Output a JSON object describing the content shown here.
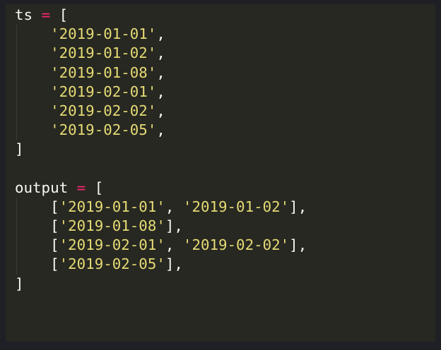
{
  "colors": {
    "background": "#1e2026",
    "editor_background": "#272822",
    "identifier": "#f8f8f2",
    "operator": "#f92672",
    "string": "#e6db74",
    "indent_guide": "#3a3b34"
  },
  "code": {
    "lines": [
      {
        "tokens": [
          {
            "t": "ts",
            "k": "id"
          },
          {
            "t": " ",
            "k": "pun"
          },
          {
            "t": "=",
            "k": "op"
          },
          {
            "t": " ",
            "k": "pun"
          },
          {
            "t": "[",
            "k": "pun"
          }
        ]
      },
      {
        "tokens": [
          {
            "t": "    ",
            "k": "ind"
          },
          {
            "t": "'2019-01-01'",
            "k": "str"
          },
          {
            "t": ",",
            "k": "pun"
          }
        ]
      },
      {
        "tokens": [
          {
            "t": "    ",
            "k": "ind"
          },
          {
            "t": "'2019-01-02'",
            "k": "str"
          },
          {
            "t": ",",
            "k": "pun"
          }
        ]
      },
      {
        "tokens": [
          {
            "t": "    ",
            "k": "ind"
          },
          {
            "t": "'2019-01-08'",
            "k": "str"
          },
          {
            "t": ",",
            "k": "pun"
          }
        ]
      },
      {
        "tokens": [
          {
            "t": "    ",
            "k": "ind"
          },
          {
            "t": "'2019-02-01'",
            "k": "str"
          },
          {
            "t": ",",
            "k": "pun"
          }
        ]
      },
      {
        "tokens": [
          {
            "t": "    ",
            "k": "ind"
          },
          {
            "t": "'2019-02-02'",
            "k": "str"
          },
          {
            "t": ",",
            "k": "pun"
          }
        ]
      },
      {
        "tokens": [
          {
            "t": "    ",
            "k": "ind"
          },
          {
            "t": "'2019-02-05'",
            "k": "str"
          },
          {
            "t": ",",
            "k": "pun"
          }
        ]
      },
      {
        "tokens": [
          {
            "t": "]",
            "k": "pun"
          }
        ]
      },
      {
        "tokens": []
      },
      {
        "tokens": [
          {
            "t": "output",
            "k": "id"
          },
          {
            "t": " ",
            "k": "pun"
          },
          {
            "t": "=",
            "k": "op"
          },
          {
            "t": " ",
            "k": "pun"
          },
          {
            "t": "[",
            "k": "pun"
          }
        ]
      },
      {
        "tokens": [
          {
            "t": "    ",
            "k": "ind"
          },
          {
            "t": "[",
            "k": "pun"
          },
          {
            "t": "'2019-01-01'",
            "k": "str"
          },
          {
            "t": ", ",
            "k": "pun"
          },
          {
            "t": "'2019-01-02'",
            "k": "str"
          },
          {
            "t": "],",
            "k": "pun"
          }
        ]
      },
      {
        "tokens": [
          {
            "t": "    ",
            "k": "ind"
          },
          {
            "t": "[",
            "k": "pun"
          },
          {
            "t": "'2019-01-08'",
            "k": "str"
          },
          {
            "t": "],",
            "k": "pun"
          }
        ]
      },
      {
        "tokens": [
          {
            "t": "    ",
            "k": "ind"
          },
          {
            "t": "[",
            "k": "pun"
          },
          {
            "t": "'2019-02-01'",
            "k": "str"
          },
          {
            "t": ", ",
            "k": "pun"
          },
          {
            "t": "'2019-02-02'",
            "k": "str"
          },
          {
            "t": "],",
            "k": "pun"
          }
        ]
      },
      {
        "tokens": [
          {
            "t": "    ",
            "k": "ind"
          },
          {
            "t": "[",
            "k": "pun"
          },
          {
            "t": "'2019-02-05'",
            "k": "str"
          },
          {
            "t": "],",
            "k": "pun"
          }
        ]
      },
      {
        "tokens": [
          {
            "t": "]",
            "k": "pun"
          }
        ]
      }
    ]
  }
}
